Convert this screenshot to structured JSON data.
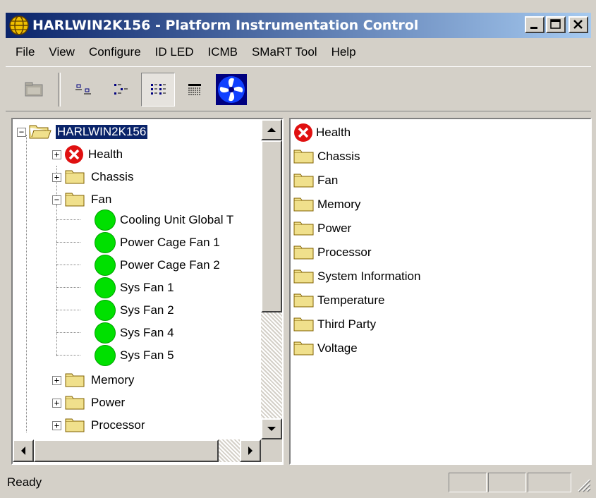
{
  "window": {
    "title": "HARLWIN2K156 - Platform Instrumentation Control",
    "minimize_icon": "minimize-icon",
    "maximize_icon": "maximize-icon",
    "close_icon": "close-icon"
  },
  "menu": [
    "File",
    "View",
    "Configure",
    "ID LED",
    "ICMB",
    "SMaRT Tool",
    "Help"
  ],
  "toolbar": {
    "buttons": [
      {
        "icon": "folder-up-icon",
        "pressed": false
      },
      {
        "icon": "large-icons-view-icon",
        "pressed": false
      },
      {
        "icon": "small-icons-view-icon",
        "pressed": false
      },
      {
        "icon": "list-view-icon",
        "pressed": true
      },
      {
        "icon": "details-view-icon",
        "pressed": false
      },
      {
        "icon": "fan-icon",
        "pressed": false
      }
    ]
  },
  "tree": {
    "root": "HARLWIN2K156",
    "items": [
      {
        "label": "Health",
        "icon": "error-icon",
        "expander": "+"
      },
      {
        "label": "Chassis",
        "icon": "folder-icon",
        "expander": "+"
      },
      {
        "label": "Fan",
        "icon": "folder-icon",
        "expander": "-"
      },
      {
        "label": "Cooling Unit Global T",
        "icon": "status-ok-icon"
      },
      {
        "label": "Power Cage Fan 1",
        "icon": "status-ok-icon"
      },
      {
        "label": "Power Cage Fan 2",
        "icon": "status-ok-icon"
      },
      {
        "label": "Sys Fan 1",
        "icon": "status-ok-icon"
      },
      {
        "label": "Sys Fan 2",
        "icon": "status-ok-icon"
      },
      {
        "label": "Sys Fan 4",
        "icon": "status-ok-icon"
      },
      {
        "label": "Sys Fan 5",
        "icon": "status-ok-icon"
      },
      {
        "label": "Memory",
        "icon": "folder-icon",
        "expander": "+"
      },
      {
        "label": "Power",
        "icon": "folder-icon",
        "expander": "+"
      },
      {
        "label": "Processor",
        "icon": "folder-icon",
        "expander": "+"
      }
    ]
  },
  "list": [
    "Health",
    "Chassis",
    "Fan",
    "Memory",
    "Power",
    "Processor",
    "System Information",
    "Temperature",
    "Third Party",
    "Voltage"
  ],
  "status": {
    "text": "Ready"
  },
  "colors": {
    "titlebar_start": "#0a246a",
    "titlebar_end": "#a6caf0",
    "ok_green": "#00e000",
    "error_red": "#e01010",
    "folder_yellow": "#f0e08c"
  }
}
